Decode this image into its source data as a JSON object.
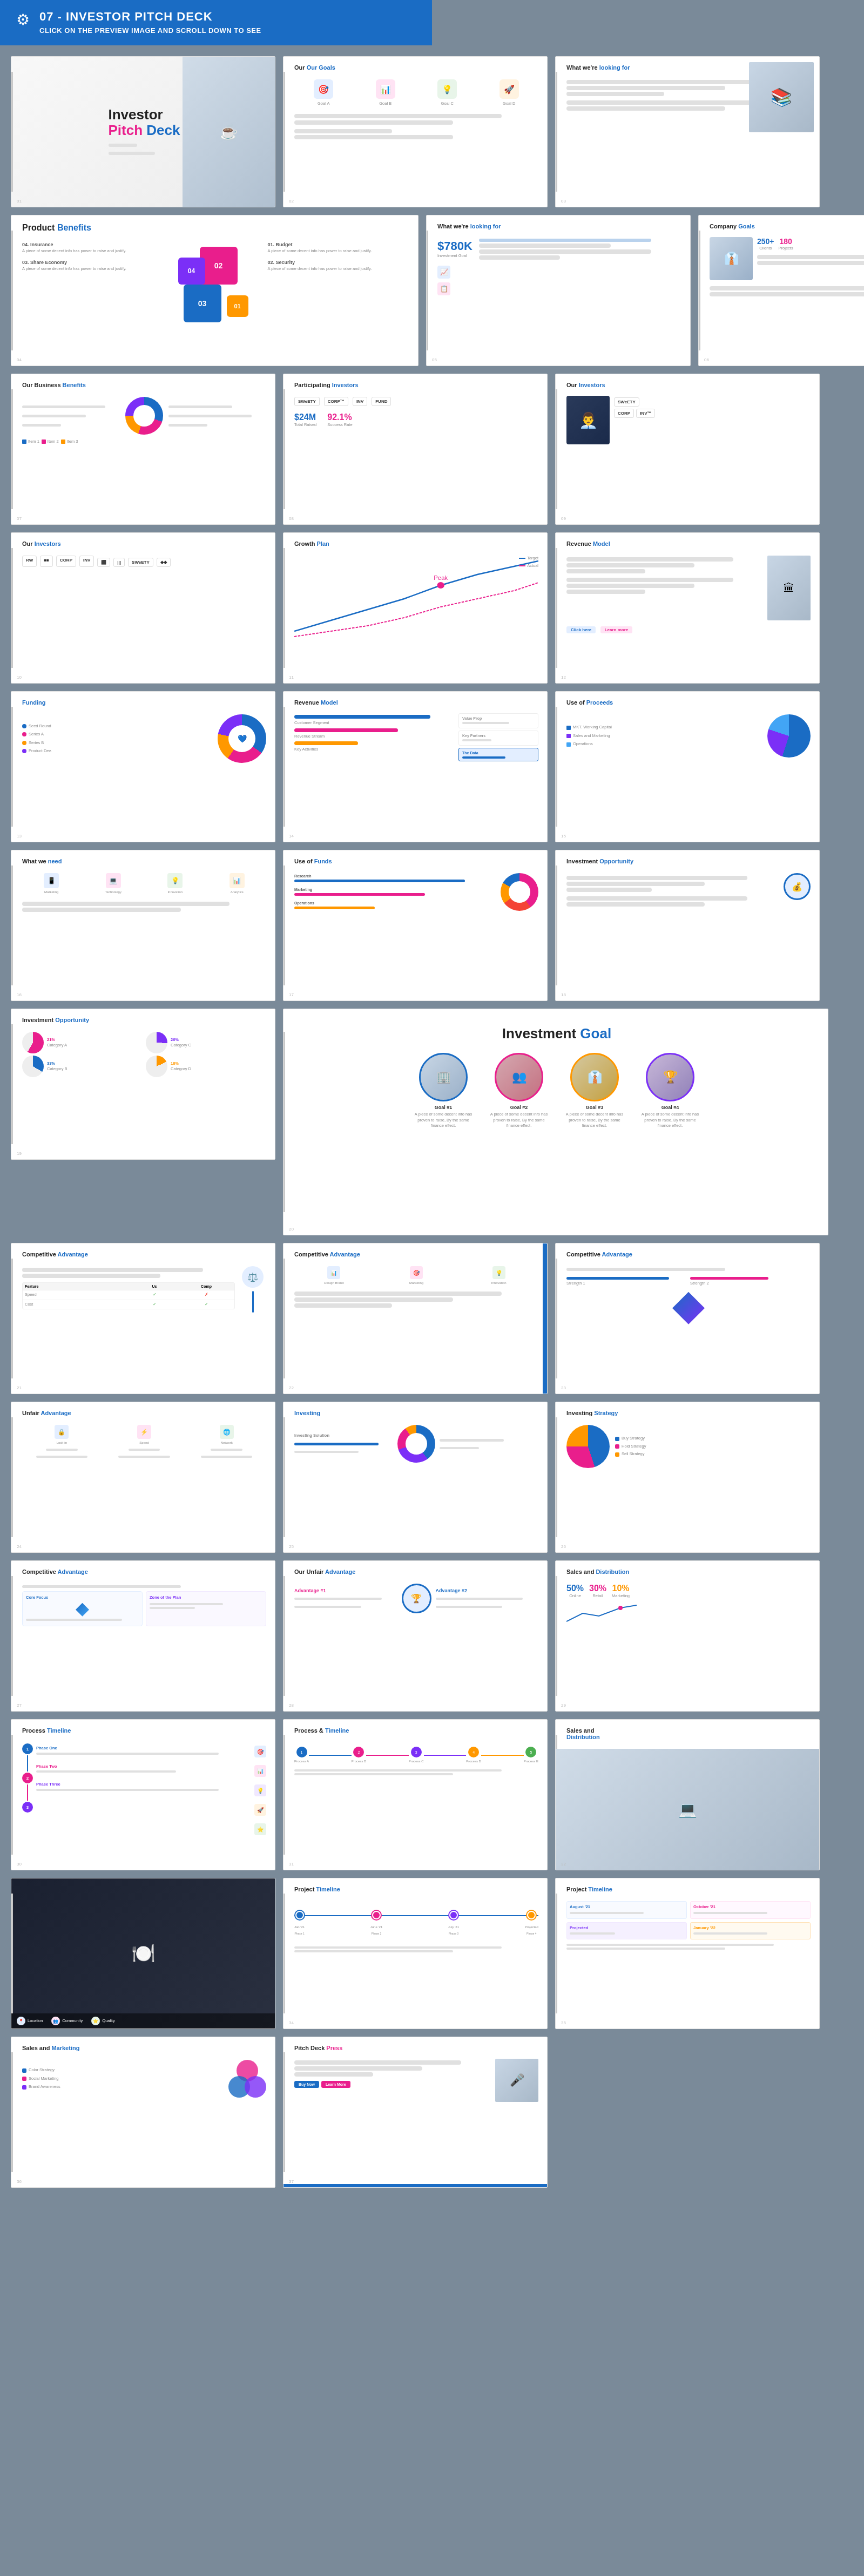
{
  "header": {
    "title": "07 - INVESTOR PITCH DECK",
    "subtitle": "CLICK ON THE PREVIEW IMAGE AND SCROLL DOWN TO SEE",
    "icon": "⚙"
  },
  "slides": [
    {
      "id": "s1",
      "title": "Investor Pitch Deck",
      "subtitle": "",
      "type": "cover"
    },
    {
      "id": "s2",
      "title": "Our Goals",
      "type": "goals"
    },
    {
      "id": "s3",
      "title": "What we're looking for",
      "type": "looking"
    },
    {
      "id": "s4",
      "title": "Product Benefits",
      "type": "benefits-large"
    },
    {
      "id": "s5",
      "title": "What we're looking for",
      "stat": "$780K",
      "type": "looking2"
    },
    {
      "id": "s6",
      "title": "Company Goals",
      "stat": "250+",
      "type": "company-goals"
    },
    {
      "id": "s7",
      "title": "Our Business Benefits",
      "type": "biz-benefits"
    },
    {
      "id": "s8",
      "title": "Participating Investors",
      "stat1": "$24M",
      "stat2": "92.1%",
      "type": "investors-participating"
    },
    {
      "id": "s9",
      "title": "Our Investors",
      "type": "our-investors"
    },
    {
      "id": "s10",
      "title": "Our Investors",
      "type": "our-investors2"
    },
    {
      "id": "s11",
      "title": "Growth Plan",
      "type": "growth-plan"
    },
    {
      "id": "s12",
      "title": "Revenue Model",
      "type": "revenue-model"
    },
    {
      "id": "s13",
      "title": "Funding",
      "type": "funding"
    },
    {
      "id": "s14",
      "title": "Revenue Model",
      "type": "revenue-model2"
    },
    {
      "id": "s15",
      "title": "Use of Proceeds",
      "type": "use-proceeds"
    },
    {
      "id": "s16",
      "title": "What we need",
      "type": "what-need"
    },
    {
      "id": "s17",
      "title": "Use of Funds",
      "type": "use-funds"
    },
    {
      "id": "s18",
      "title": "Investment Opportunity",
      "type": "invest-opp"
    },
    {
      "id": "s19",
      "title": "Investment Opportunity",
      "percentages": [
        "21%",
        "33%",
        "26%",
        "18%"
      ],
      "type": "invest-opp2"
    },
    {
      "id": "s20",
      "title": "Investment Goal",
      "goals": [
        {
          "label": "Goal #1",
          "desc": "A piece of some decent info has proven to raise and justify."
        },
        {
          "label": "Goal #2",
          "desc": "A piece of some decent info has proven to raise and justify."
        },
        {
          "label": "Goal #3",
          "desc": "A piece of some decent info has proven to raise and justify."
        },
        {
          "label": "Goal #4",
          "desc": "A piece of some decent info has proven to raise and justify."
        }
      ],
      "type": "invest-goal-large"
    },
    {
      "id": "s21",
      "title": "Competitive Advantage",
      "type": "comp-adv"
    },
    {
      "id": "s22",
      "title": "Competitive Advantage",
      "type": "comp-adv2"
    },
    {
      "id": "s23",
      "title": "Competitive Advantage",
      "type": "comp-adv3"
    },
    {
      "id": "s24",
      "title": "Unfair Advantage",
      "type": "unfair-adv"
    },
    {
      "id": "s25",
      "title": "Investing",
      "type": "investing"
    },
    {
      "id": "s26",
      "title": "Investing Strategy",
      "type": "invest-strategy"
    },
    {
      "id": "s27",
      "title": "Competitive Advantage",
      "type": "comp-adv4"
    },
    {
      "id": "s28",
      "title": "Our Unfair Advantage",
      "type": "unfair-adv2"
    },
    {
      "id": "s29",
      "title": "Sales and Distribution",
      "percentages": [
        "50%",
        "30%",
        "10%"
      ],
      "type": "sales-dist"
    },
    {
      "id": "s30",
      "title": "Process Timeline",
      "type": "process-timeline"
    },
    {
      "id": "s31",
      "title": "Process & Timeline",
      "type": "process-timeline2"
    },
    {
      "id": "s32",
      "title": "Sales and Distribution",
      "type": "sales-dist2"
    },
    {
      "id": "s33",
      "title": "Sales and Marketing",
      "type": "sales-mkt"
    },
    {
      "id": "s34",
      "title": "",
      "type": "photo-wide"
    },
    {
      "id": "s35",
      "title": "Project Timeline",
      "type": "proj-timeline"
    },
    {
      "id": "s36",
      "title": "Project Timeline",
      "type": "proj-timeline2"
    },
    {
      "id": "s37",
      "title": "Pitch Deck Press",
      "type": "pitch-press"
    }
  ],
  "labels": {
    "our_goals": "Our Goals",
    "what_looking": "What we're looking for",
    "product_benefits": "Product Benefits",
    "product_benefits_accent": "Benefits",
    "company_goals": "Company Goals",
    "our_business_benefits": "Our Business Benefits",
    "participating_investors": "Participating Investors",
    "participating_investors_accent": "Investors",
    "our_investors": "Our Investors",
    "our_investors_accent": "Investors",
    "growth_plan": "Growth Plan",
    "revenue_model": "Revenue Model",
    "revenue_model_accent": "Model",
    "funding": "Funding",
    "use_of_proceeds": "Use of Proceeds",
    "use_of_proceeds_accent": "Proceeds",
    "what_we_need": "What we need",
    "what_we_need_accent": "need",
    "use_of_funds": "Use of Funds",
    "use_of_funds_accent": "Funds",
    "investment_opportunity": "Investment Opportunity",
    "investment_opportunity_accent": "Opportunity",
    "investment_goal": "Investment",
    "investment_goal_accent": "Goal",
    "competitive_advantage": "Competitive Advantage",
    "competitive_advantage_accent": "Advantage",
    "unfair_advantage": "Unfair Advantage",
    "unfair_advantage_accent": "Advantage",
    "investing": "Investing",
    "investing_strategy": "Investing Strategy",
    "investing_strategy_accent": "Strategy",
    "our_unfair_advantage": "Our Unfair Advantage",
    "our_unfair_advantage_accent": "Advantage",
    "sales_distribution": "Sales and Distribution",
    "sales_distribution_accent": "Distribution",
    "process_timeline": "Process Timeline",
    "process_timeline_accent": "Timeline",
    "process_and_timeline": "Process & Timeline",
    "process_and_timeline_accent": "Timeline",
    "sales_marketing": "Sales and Marketing",
    "sales_marketing_accent": "Marketing",
    "project_timeline": "Project Timeline",
    "project_timeline_accent": "Timeline",
    "pitch_deck_press": "Pitch Deck Press",
    "pitch_deck_press_accent": "Press"
  }
}
